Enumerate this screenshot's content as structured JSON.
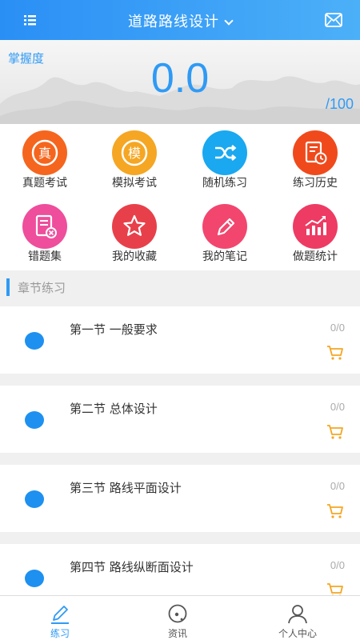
{
  "header": {
    "title": "道路路线设计",
    "menu_icon": "list-menu-icon",
    "mail_icon": "mail-icon"
  },
  "mastery": {
    "label": "掌握度",
    "value": "0.0",
    "max": "/100"
  },
  "features": [
    {
      "label": "真题考试",
      "glyph": "真",
      "color": "#f5651e"
    },
    {
      "label": "模拟考试",
      "glyph": "模",
      "color": "#f5a623"
    },
    {
      "label": "随机练习",
      "color": "#1aa8f0"
    },
    {
      "label": "练习历史",
      "color": "#f04a1c"
    },
    {
      "label": "错题集",
      "color": "#ee4e9c"
    },
    {
      "label": "我的收藏",
      "color": "#e8404a"
    },
    {
      "label": "我的笔记",
      "color": "#f2466e"
    },
    {
      "label": "做题统计",
      "color": "#ee3b63"
    }
  ],
  "section": {
    "title": "章节练习"
  },
  "chapters": [
    {
      "name": "第一节 一般要求",
      "count": "0/0"
    },
    {
      "name": "第二节 总体设计",
      "count": "0/0"
    },
    {
      "name": "第三节 路线平面设计",
      "count": "0/0"
    },
    {
      "name": "第四节 路线纵断面设计",
      "count": "0/0"
    }
  ],
  "tabs": [
    {
      "label": "练习",
      "icon": "pencil-icon",
      "active": true
    },
    {
      "label": "资讯",
      "icon": "news-icon",
      "active": false
    },
    {
      "label": "个人中心",
      "icon": "person-icon",
      "active": false
    }
  ],
  "colors": {
    "accent": "#2f9af5",
    "cart": "#f5a623",
    "chapter_dot": "#1e90f0"
  }
}
